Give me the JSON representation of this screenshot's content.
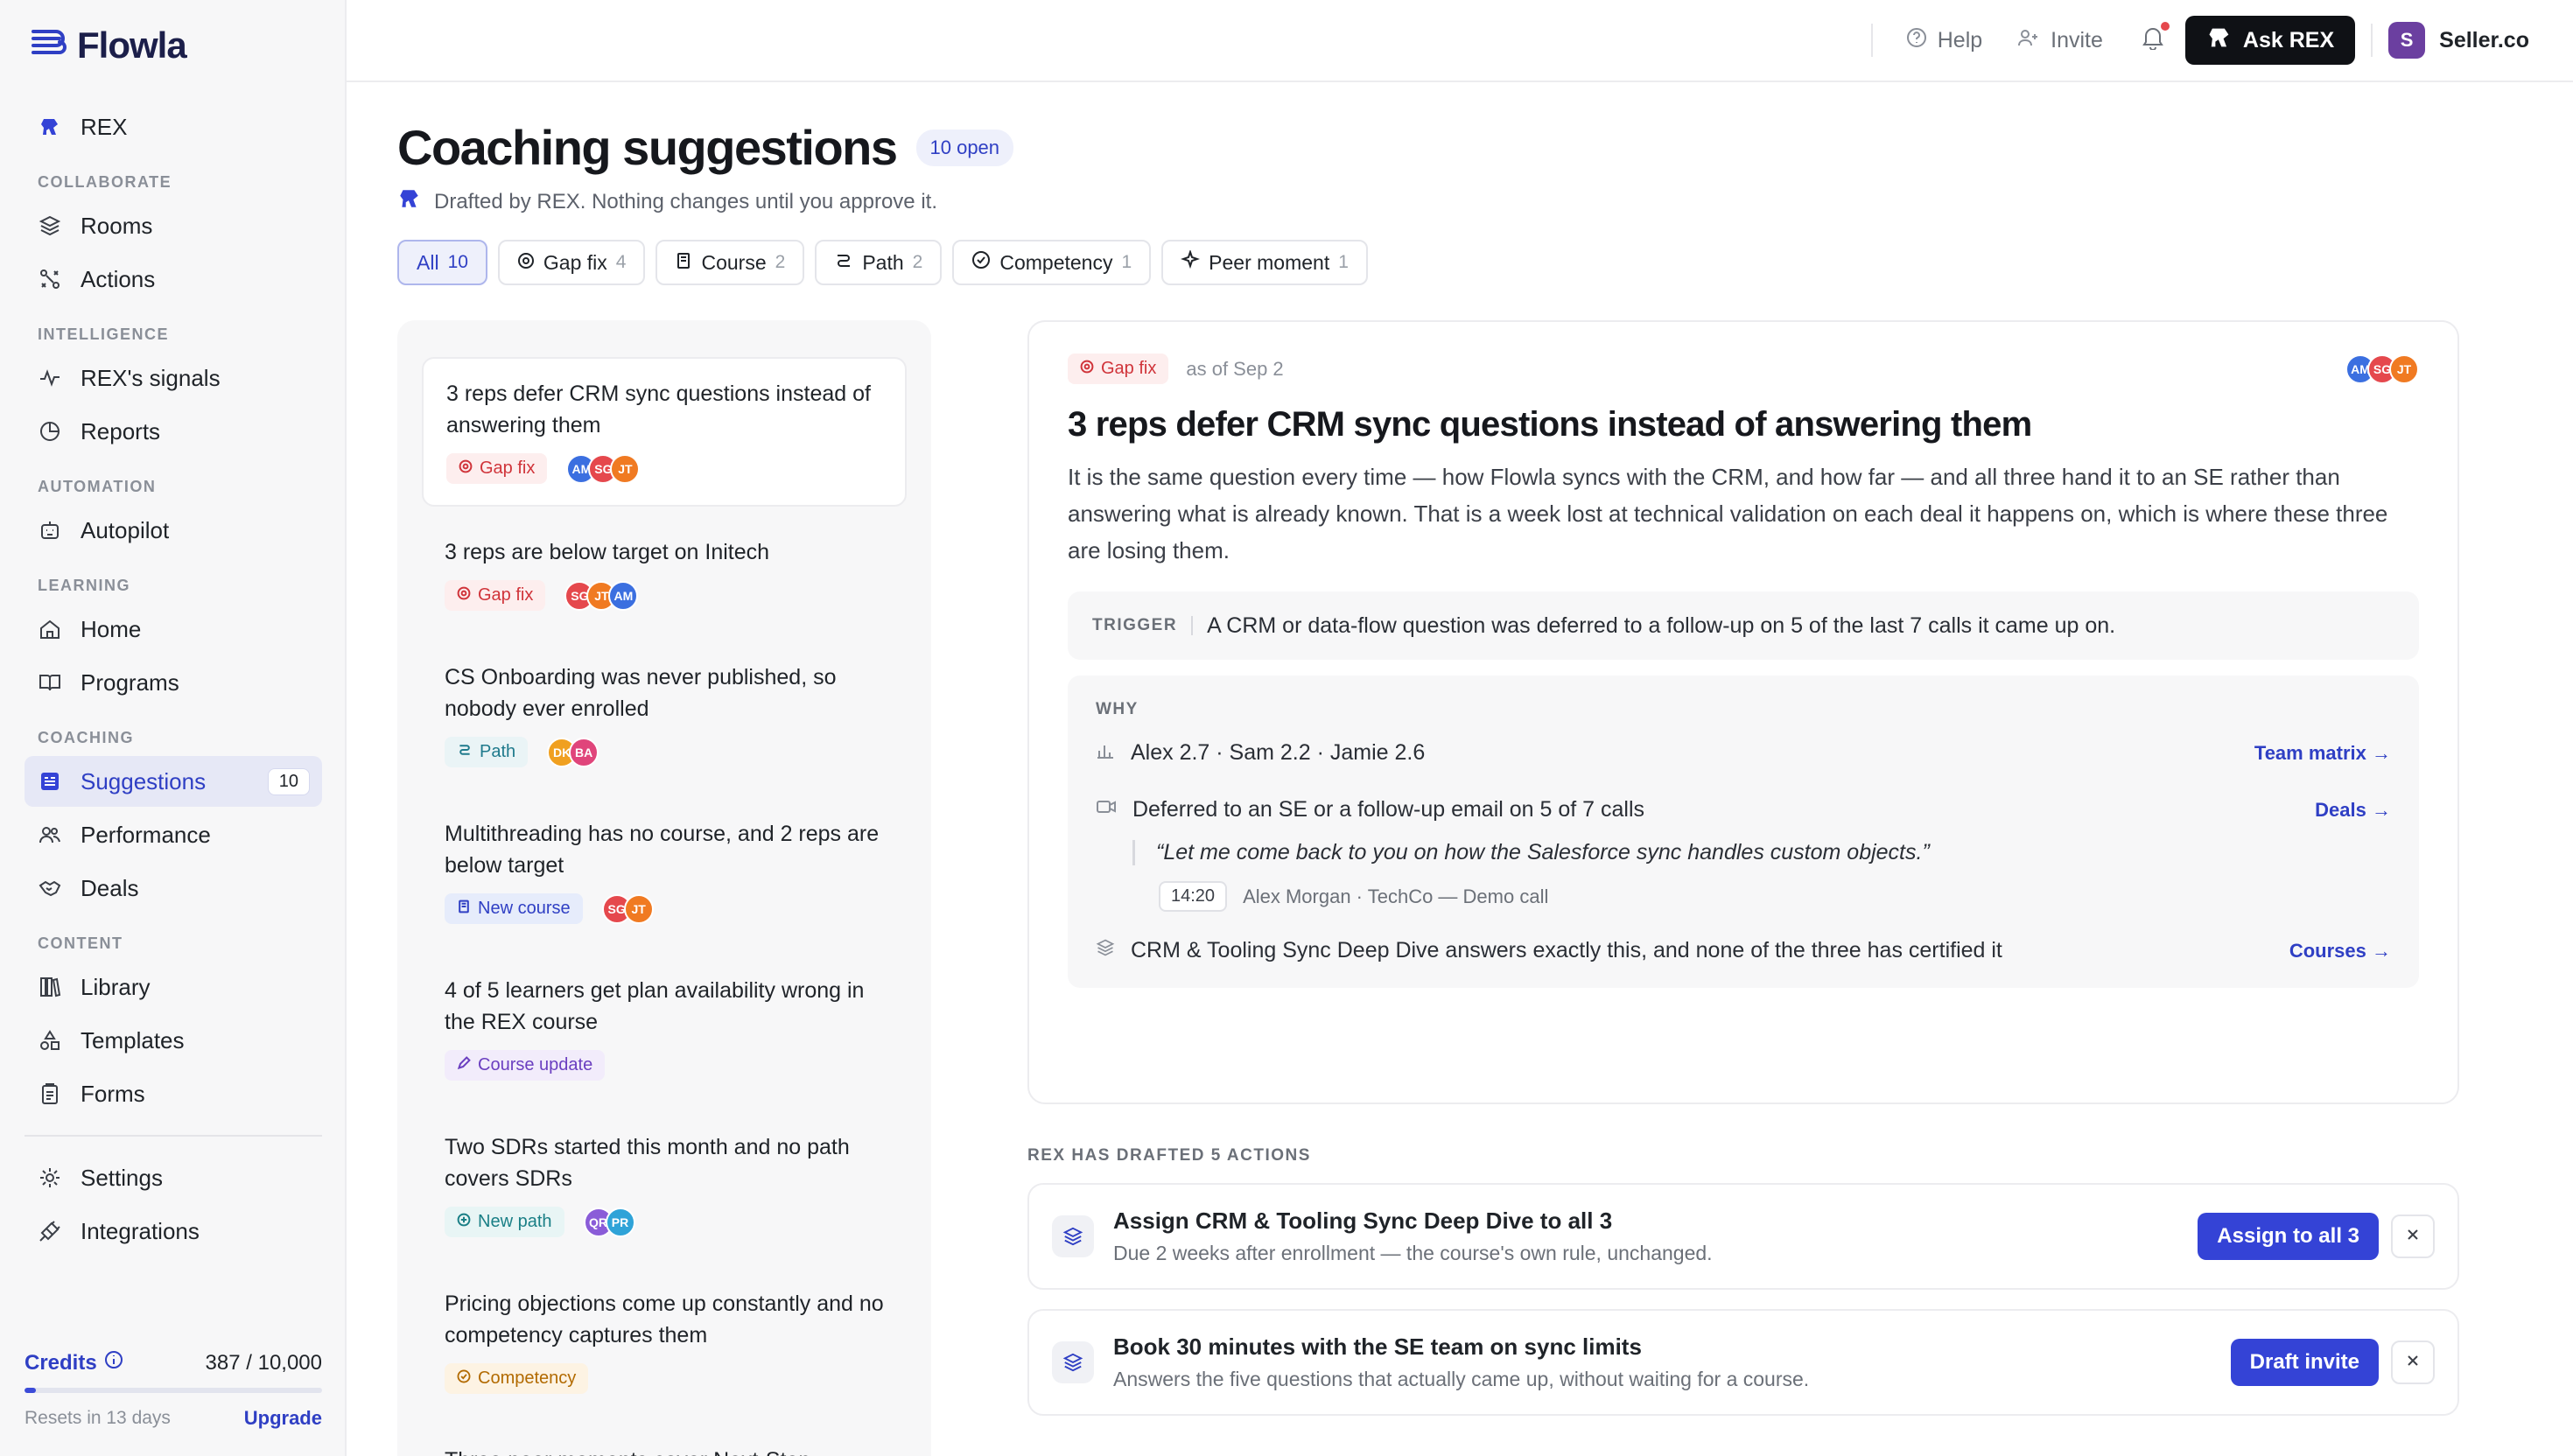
{
  "app": {
    "name": "Flowla"
  },
  "sidebar": {
    "top_item": "REX",
    "sections": {
      "collaborate": "COLLABORATE",
      "intelligence": "INTELLIGENCE",
      "automation": "AUTOMATION",
      "learning": "LEARNING",
      "coaching": "COACHING",
      "content": "CONTENT"
    },
    "items": {
      "rooms": "Rooms",
      "actions": "Actions",
      "signals": "REX's signals",
      "reports": "Reports",
      "autopilot": "Autopilot",
      "home": "Home",
      "programs": "Programs",
      "suggestions": "Suggestions",
      "suggestions_badge": "10",
      "performance": "Performance",
      "deals": "Deals",
      "library": "Library",
      "templates": "Templates",
      "forms": "Forms",
      "settings": "Settings",
      "integrations": "Integrations"
    },
    "credits": {
      "label": "Credits",
      "value": "387 / 10,000",
      "used_fraction": 0.0387,
      "resets": "Resets in 13 days",
      "upgrade": "Upgrade"
    }
  },
  "topbar": {
    "help": "Help",
    "invite": "Invite",
    "ask": "Ask REX",
    "org_initial": "S",
    "org_name": "Seller.co"
  },
  "header": {
    "title": "Coaching suggestions",
    "open_pill": "10 open",
    "subtitle": "Drafted by REX. Nothing changes until you approve it."
  },
  "filters": [
    {
      "label": "All",
      "count": "10"
    },
    {
      "label": "Gap fix",
      "count": "4"
    },
    {
      "label": "Course",
      "count": "2"
    },
    {
      "label": "Path",
      "count": "2"
    },
    {
      "label": "Competency",
      "count": "1"
    },
    {
      "label": "Peer moment",
      "count": "1"
    }
  ],
  "list": [
    {
      "title": "3 reps defer CRM sync questions instead of answering them",
      "tag": "Gap fix",
      "avatars": [
        "AM",
        "SG",
        "JT"
      ]
    },
    {
      "title": "3 reps are below target on Initech",
      "tag": "Gap fix",
      "avatars": [
        "SG",
        "JT",
        "AM"
      ]
    },
    {
      "title": "CS Onboarding was never published, so nobody ever enrolled",
      "tag": "Path",
      "avatars": [
        "DK",
        "BA"
      ]
    },
    {
      "title": "Multithreading has no course, and 2 reps are below target",
      "tag": "New course",
      "avatars": [
        "SG",
        "JT"
      ]
    },
    {
      "title": "4 of 5 learners get plan availability wrong in the REX course",
      "tag": "Course update",
      "avatars": []
    },
    {
      "title": "Two SDRs started this month and no path covers SDRs",
      "tag": "New path",
      "avatars": [
        "QR",
        "PR"
      ]
    },
    {
      "title": "Pricing objections come up constantly and no competency captures them",
      "tag": "Competency",
      "avatars": []
    },
    {
      "title": "Three peer moments cover Next-Step",
      "tag": "",
      "avatars": []
    }
  ],
  "detail": {
    "tag": "Gap fix",
    "asof": "as of Sep 2",
    "avatars": [
      "AM",
      "SG",
      "JT"
    ],
    "title": "3 reps defer CRM sync questions instead of answering them",
    "body": "It is the same question every time — how Flowla syncs with the CRM, and how far — and all three hand it to an SE rather than answering what is already known. That is a week lost at technical validation on each deal it happens on, which is where these three are losing them.",
    "trigger_label": "TRIGGER",
    "trigger_text": "A CRM or data-flow question was deferred to a follow-up on 5 of the last 7 calls it came up on.",
    "why_label": "WHY",
    "why": {
      "scores": "Alex 2.7 · Sam 2.2 · Jamie 2.6",
      "scores_link": "Team matrix →",
      "deferred": "Deferred to an SE or a follow-up email on 5 of 7 calls",
      "deferred_link": "Deals →",
      "quote": "“Let me come back to you on how the Salesforce sync handles custom objects.”",
      "quote_time": "14:20",
      "quote_source": "Alex Morgan · TechCo — Demo call",
      "course": "CRM & Tooling Sync Deep Dive answers exactly this, and none of the three has certified it",
      "course_link": "Courses →"
    }
  },
  "actions": {
    "label": "REX HAS DRAFTED 5 ACTIONS",
    "items": [
      {
        "title": "Assign CRM & Tooling Sync Deep Dive to all 3",
        "desc": "Due 2 weeks after enrollment — the course's own rule, unchanged.",
        "button": "Assign to all 3"
      },
      {
        "title": "Book 30 minutes with the SE team on sync limits",
        "desc": "Answers the five questions that actually came up, without waiting for a course.",
        "button": "Draft invite"
      }
    ]
  },
  "colors": {
    "accent": "#3443d6",
    "gap_fix": "#d0343a",
    "avatar_am": "#3b6fe0",
    "avatar_sg": "#e5484d",
    "avatar_jt": "#f07a22",
    "avatar_dk": "#f0a020",
    "avatar_ba": "#e0457b",
    "avatar_qr": "#8a5cd8",
    "avatar_pr": "#2fa3d8"
  }
}
